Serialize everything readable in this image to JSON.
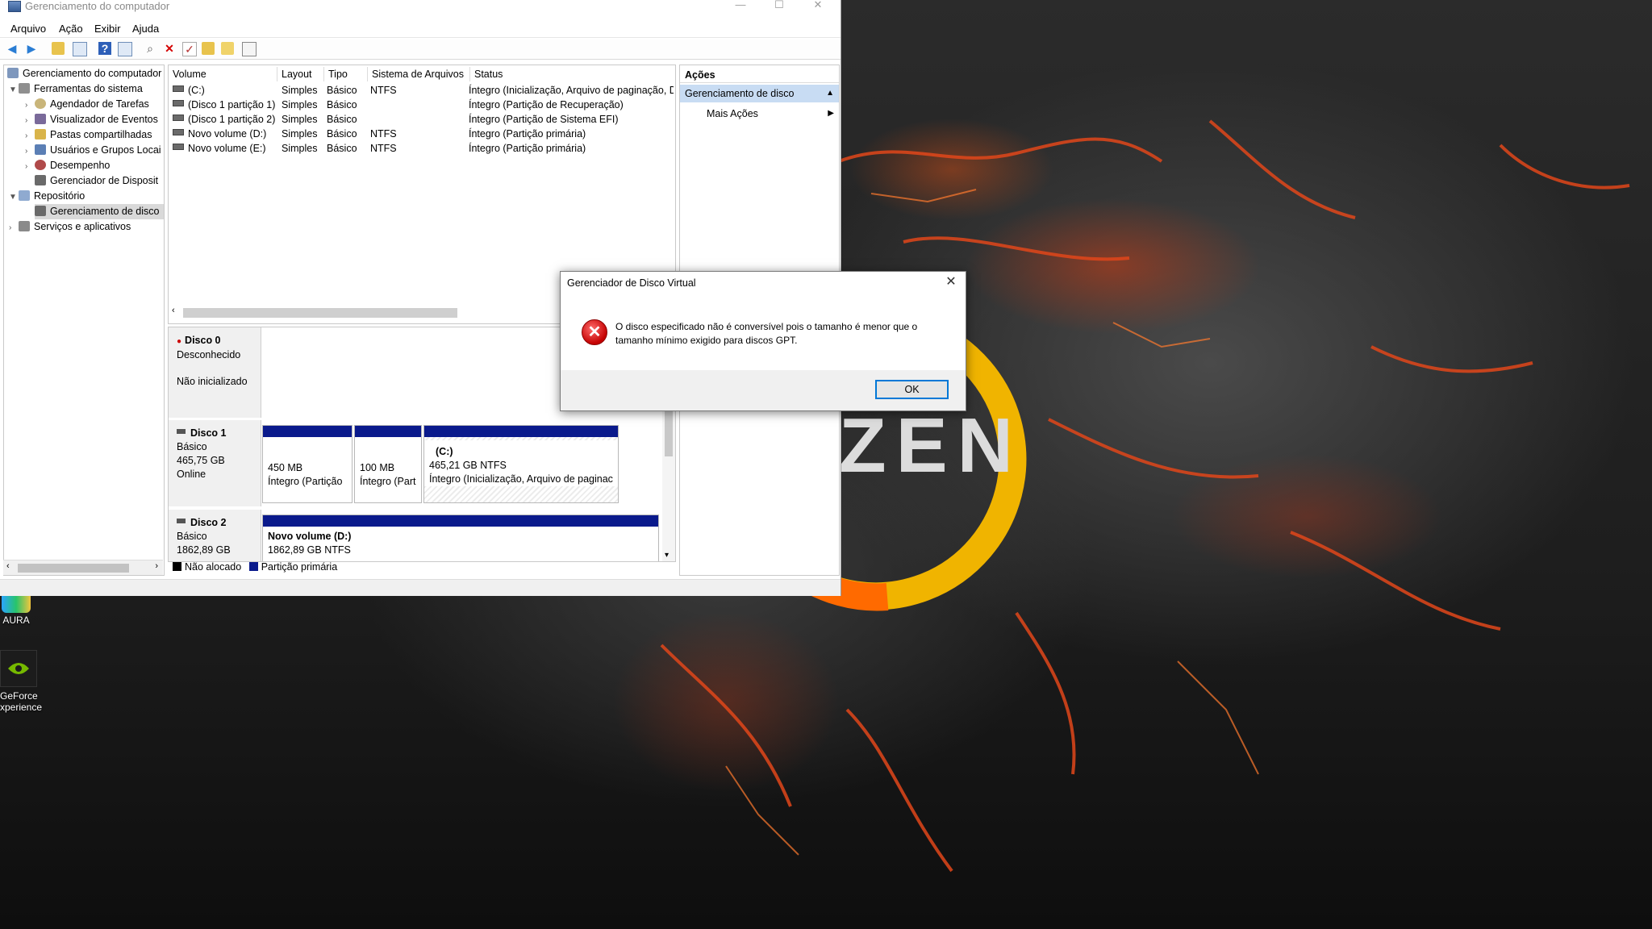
{
  "window": {
    "title": "Gerenciamento do computador",
    "controls": {
      "minimize": "—",
      "maximize": "☐",
      "close": "✕"
    }
  },
  "menu": [
    "Arquivo",
    "Ação",
    "Exibir",
    "Ajuda"
  ],
  "toolbar_icons": [
    "back-arrow-icon",
    "forward-arrow-icon",
    "up-folder-icon",
    "show-hide-tree-icon",
    "help-icon",
    "properties-icon",
    "connect-icon",
    "delete-icon",
    "checklist-icon",
    "folder-new-icon",
    "folder-open-icon",
    "view-icon"
  ],
  "tree": {
    "root": "Gerenciamento do computador",
    "items": [
      {
        "label": "Ferramentas do sistema",
        "level": 1,
        "expanded": true
      },
      {
        "label": "Agendador de Tarefas",
        "level": 2
      },
      {
        "label": "Visualizador de Eventos",
        "level": 2
      },
      {
        "label": "Pastas compartilhadas",
        "level": 2
      },
      {
        "label": "Usuários e Grupos Locai",
        "level": 2
      },
      {
        "label": "Desempenho",
        "level": 2
      },
      {
        "label": "Gerenciador de Disposit",
        "level": 2
      },
      {
        "label": "Repositório",
        "level": 1,
        "expanded": true
      },
      {
        "label": "Gerenciamento de disco",
        "level": 2,
        "selected": true
      },
      {
        "label": "Serviços e aplicativos",
        "level": 1
      }
    ]
  },
  "volume_list": {
    "columns": [
      "Volume",
      "Layout",
      "Tipo",
      "Sistema de Arquivos",
      "Status"
    ],
    "rows": [
      {
        "volume": "(C:)",
        "layout": "Simples",
        "tipo": "Básico",
        "fs": "NTFS",
        "status": "Íntegro (Inicialização, Arquivo de paginação, D"
      },
      {
        "volume": "(Disco 1 partição 1)",
        "layout": "Simples",
        "tipo": "Básico",
        "fs": "",
        "status": "Íntegro (Partição de Recuperação)"
      },
      {
        "volume": "(Disco 1 partição 2)",
        "layout": "Simples",
        "tipo": "Básico",
        "fs": "",
        "status": "Íntegro (Partição de Sistema EFI)"
      },
      {
        "volume": "Novo volume (D:)",
        "layout": "Simples",
        "tipo": "Básico",
        "fs": "NTFS",
        "status": "Íntegro (Partição primária)"
      },
      {
        "volume": "Novo volume (E:)",
        "layout": "Simples",
        "tipo": "Básico",
        "fs": "NTFS",
        "status": "Íntegro (Partição primária)"
      }
    ]
  },
  "disks": {
    "disk0": {
      "name": "Disco 0",
      "type": "Desconhecido",
      "state": "Não inicializado"
    },
    "disk1": {
      "name": "Disco 1",
      "type": "Básico",
      "size": "465,75 GB",
      "state": "Online",
      "partitions": [
        {
          "size": "450 MB",
          "status": "Íntegro (Partição"
        },
        {
          "size": "100 MB",
          "status": "Íntegro (Part"
        },
        {
          "name": "(C:)",
          "size": "465,21 GB NTFS",
          "status": "Íntegro (Inicialização, Arquivo de paginac"
        }
      ]
    },
    "disk2": {
      "name": "Disco 2",
      "type": "Básico",
      "size": "1862,89 GB",
      "partitions": [
        {
          "name": "Novo volume  (D:)",
          "size": "1862,89 GB NTFS"
        }
      ]
    }
  },
  "legend": {
    "unallocated": "Não alocado",
    "primary": "Partição primária",
    "unallocated_color": "#000000",
    "primary_color": "#0a1a8c"
  },
  "actions": {
    "title": "Ações",
    "group": "Gerenciamento de disco",
    "more": "Mais Ações"
  },
  "dialog": {
    "title": "Gerenciador de Disco Virtual",
    "message": "O disco especificado não é conversível pois o tamanho é menor que o tamanho mínimo exigido para discos GPT.",
    "ok": "OK",
    "close": "✕"
  },
  "desktop": {
    "icons": [
      {
        "label": "AURA"
      },
      {
        "label": "GeForce\nxperience"
      }
    ],
    "logo_text": "ZEN"
  },
  "colors": {
    "accent": "#0078d7",
    "partition_bar": "#0a1a8c",
    "error": "#c40000"
  }
}
